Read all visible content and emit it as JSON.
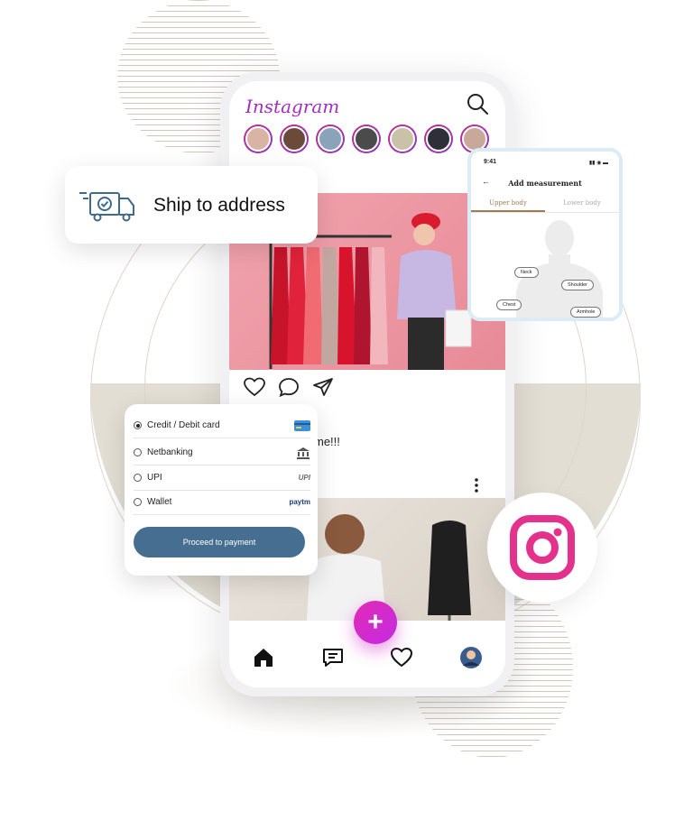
{
  "feed": {
    "app_name": "Instagram",
    "caption": "me!!!"
  },
  "ship": {
    "label": "Ship to address"
  },
  "measurement": {
    "status_time": "9:41",
    "status_icons": "▮▮ ◉ ▬",
    "back_glyph": "←",
    "title": "Add measurement",
    "tabs": [
      {
        "label": "Upper body",
        "active": true
      },
      {
        "label": "Lower body",
        "active": false
      }
    ],
    "chips": [
      "Neck",
      "Shoulder",
      "Chest",
      "Armhole"
    ]
  },
  "payment": {
    "options": [
      {
        "label": "Credit / Debit card",
        "selected": true,
        "logo": "card-icon"
      },
      {
        "label": "Netbanking",
        "selected": false,
        "logo": "bank-icon"
      },
      {
        "label": "UPI",
        "selected": false,
        "logo": "UPI"
      },
      {
        "label": "Wallet",
        "selected": false,
        "logo": "Paytm"
      }
    ],
    "upi_logo_text": "UPI",
    "wallet_logo_text": "paytm",
    "proceed_label": "Proceed to payment"
  },
  "colors": {
    "brand_purple": "#a22ec0",
    "fab_pink": "#e22bb5",
    "pay_button": "#466e90",
    "instagram_pink": "#e4318b"
  }
}
